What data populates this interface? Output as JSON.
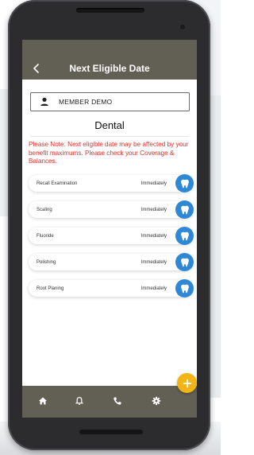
{
  "app_bar": {
    "title": "Next Eligible Date"
  },
  "member": {
    "name": "MEMBER DEMO"
  },
  "section": {
    "title": "Dental"
  },
  "note": "Please Note: Next eligible date may be affected by your benefit maximums. Please check your Coverage & Balances.",
  "items": [
    {
      "label": "Recall Examination",
      "status": "Immediately"
    },
    {
      "label": "Scaling",
      "status": "Immediately"
    },
    {
      "label": "Fluoride",
      "status": "Immediately"
    },
    {
      "label": "Polishing",
      "status": "Immediately"
    },
    {
      "label": "Root Planing",
      "status": "Immediately"
    }
  ],
  "colors": {
    "app_bar": "#625f55",
    "note_text": "#e2302c",
    "tooth_button": "#2e88d6",
    "fab": "#f3b415"
  },
  "icons": {
    "back": "chevron-left-icon",
    "member": "person-icon",
    "item_action": "tooth-icon",
    "fab": "plus-icon",
    "nav": [
      "home-icon",
      "bell-icon",
      "phone-icon",
      "gear-icon"
    ]
  }
}
